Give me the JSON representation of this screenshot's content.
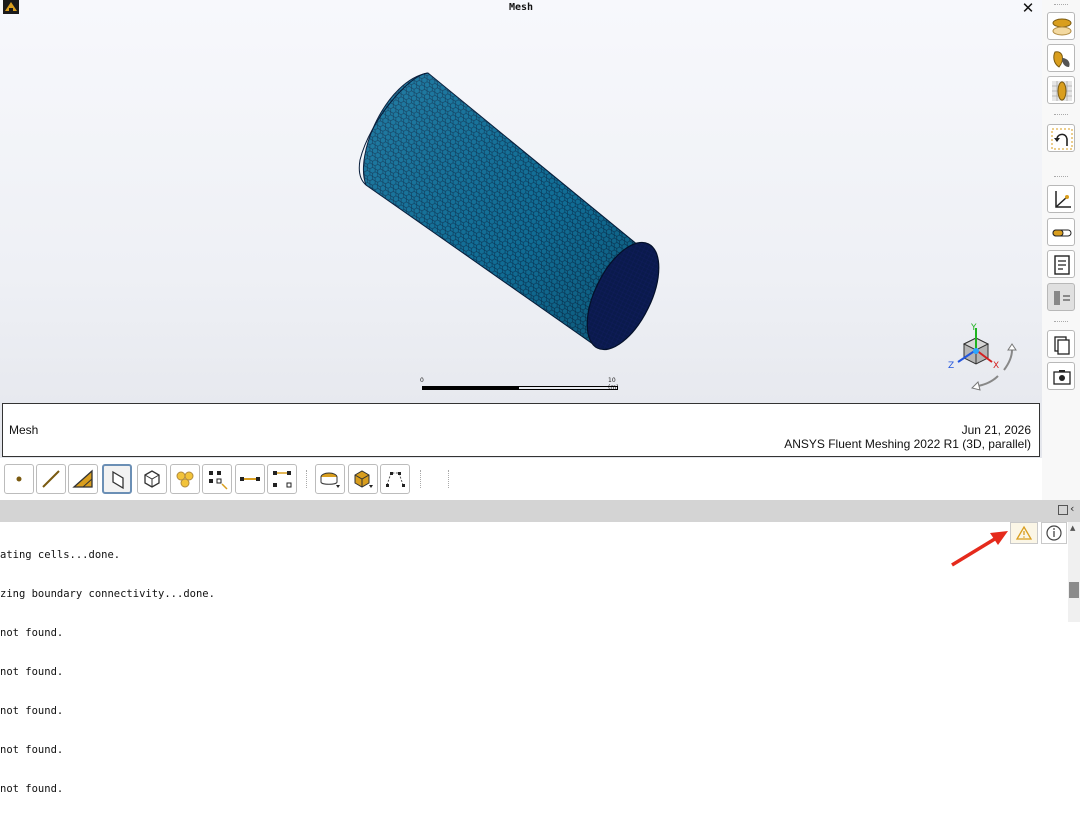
{
  "window": {
    "title": "Mesh",
    "close_label": "✕"
  },
  "scale_bar": {
    "min_label": "0",
    "max_label": "10 (m)"
  },
  "caption": {
    "name": "Mesh",
    "date": "Jun 21, 2026",
    "product": "ANSYS Fluent Meshing 2022 R1 (3D, parallel)"
  },
  "triad": {
    "x_label": "X",
    "y_label": "Y",
    "z_label": "Z"
  },
  "right_toolbar": [
    "clipping-planes",
    "draw-options",
    "mesh-display",
    "reset-view",
    "axes",
    "colormap",
    "annotations",
    "toolbar-layout",
    "copy",
    "screenshot"
  ],
  "selection_toolbar": [
    "point",
    "edge",
    "triangle",
    "face",
    "cell",
    "multi-cell",
    "select-nodes",
    "select-edge-path",
    "select-position",
    "zone-face",
    "zone-cell",
    "polyline"
  ],
  "console": {
    "lines": [
      "ating cells...done.",
      "zing boundary connectivity...done.",
      "not found.",
      "not found.",
      "not found.",
      "not found.",
      "not found."
    ]
  },
  "colors": {
    "mesh_fill": "#0e5f85",
    "mesh_line": "#061c3a",
    "end_cap": "#0a1a4a",
    "accent_gold": "#d99e1e",
    "arrow_red": "#e52a1c"
  }
}
